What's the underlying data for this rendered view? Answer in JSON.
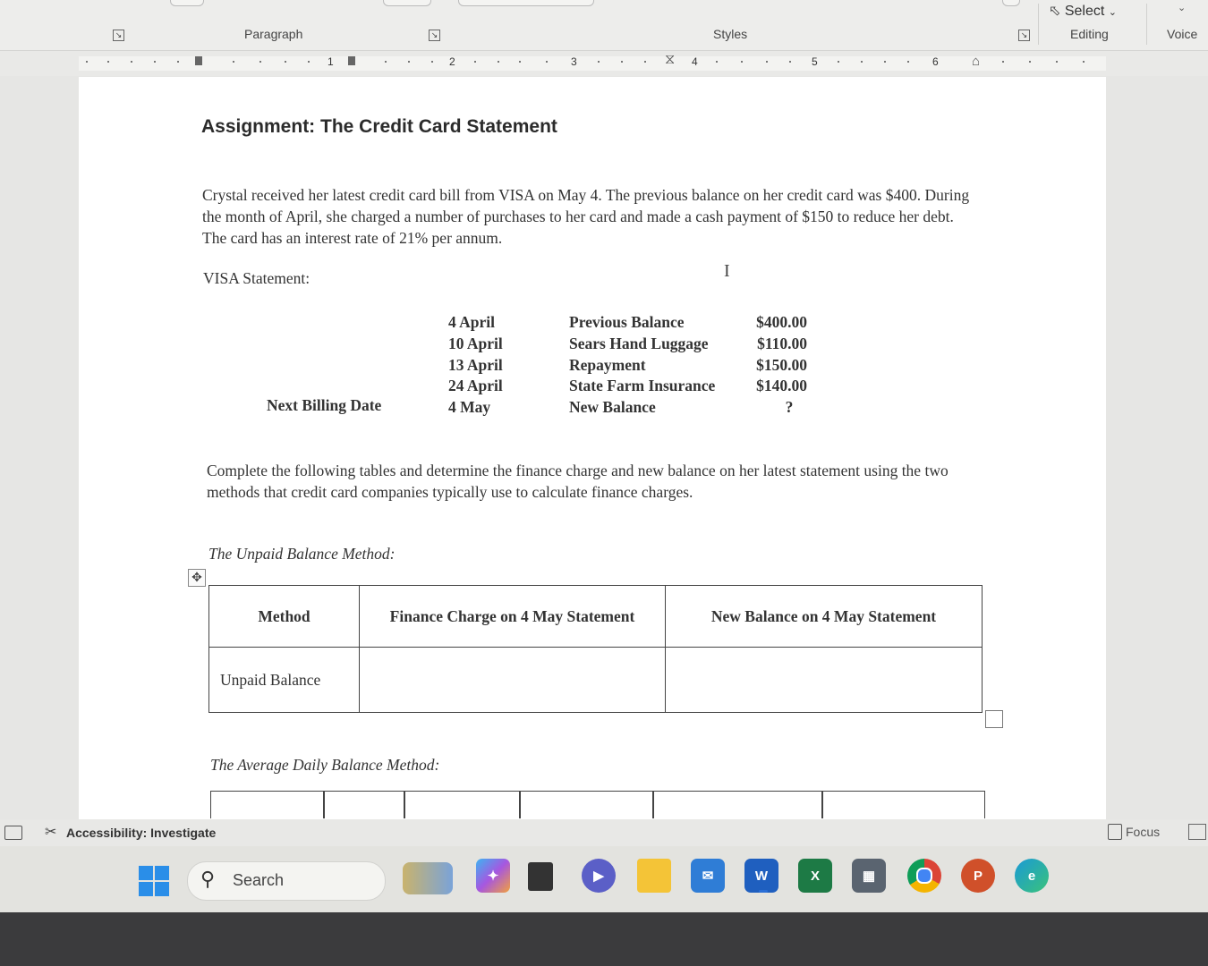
{
  "ribbon": {
    "paragraph_group": "Paragraph",
    "styles_group": "Styles",
    "select_label": "Select",
    "editing_group": "Editing",
    "voice_group": "Voice"
  },
  "ruler": {
    "numbers": [
      "1",
      "2",
      "3",
      "4",
      "5",
      "6"
    ]
  },
  "document": {
    "title": "Assignment: The Credit Card Statement",
    "paragraph1": "Crystal received her latest credit card bill from VISA on May 4. The previous balance on her credit card was $400. During the month of April, she charged a number of purchases to her card and made a cash payment of $150 to reduce her debt. The card has an interest rate of 21% per annum.",
    "visa_label": "VISA Statement:",
    "next_billing_label": "Next Billing Date",
    "statement": {
      "dates": [
        "4 April",
        "10 April",
        "13 April",
        "24 April",
        "4 May"
      ],
      "descriptions": [
        "Previous Balance",
        "Sears Hand Luggage",
        "Repayment",
        "State Farm Insurance",
        "New Balance"
      ],
      "amounts": [
        "$400.00",
        "$110.00",
        "$150.00",
        "$140.00",
        "?"
      ]
    },
    "paragraph2": "Complete the following tables and determine the finance charge and new balance on her latest statement using the two methods that credit card companies typically use to calculate finance charges.",
    "unpaid_method_label": "The Unpaid Balance Method:",
    "unpaid_table": {
      "headers": [
        "Method",
        "Finance Charge on 4 May Statement",
        "New Balance on 4 May Statement"
      ],
      "row": [
        "Unpaid Balance",
        "",
        ""
      ]
    },
    "avg_method_label": "The Average Daily Balance Method:"
  },
  "statusbar": {
    "accessibility": "Accessibility: Investigate",
    "focus": "Focus"
  },
  "taskbar": {
    "search_placeholder": "Search",
    "apps": [
      "Copilot",
      "Files",
      "Meet",
      "File Explorer",
      "Mail",
      "Word",
      "Excel",
      "Calculator",
      "Chrome",
      "PowerPoint",
      "Edge"
    ]
  },
  "colors": {
    "word_blue": "#1f5fbf",
    "excel_green": "#1d7a45",
    "powerpoint_red": "#d0502a",
    "edge_blue": "#1a9ad6"
  }
}
